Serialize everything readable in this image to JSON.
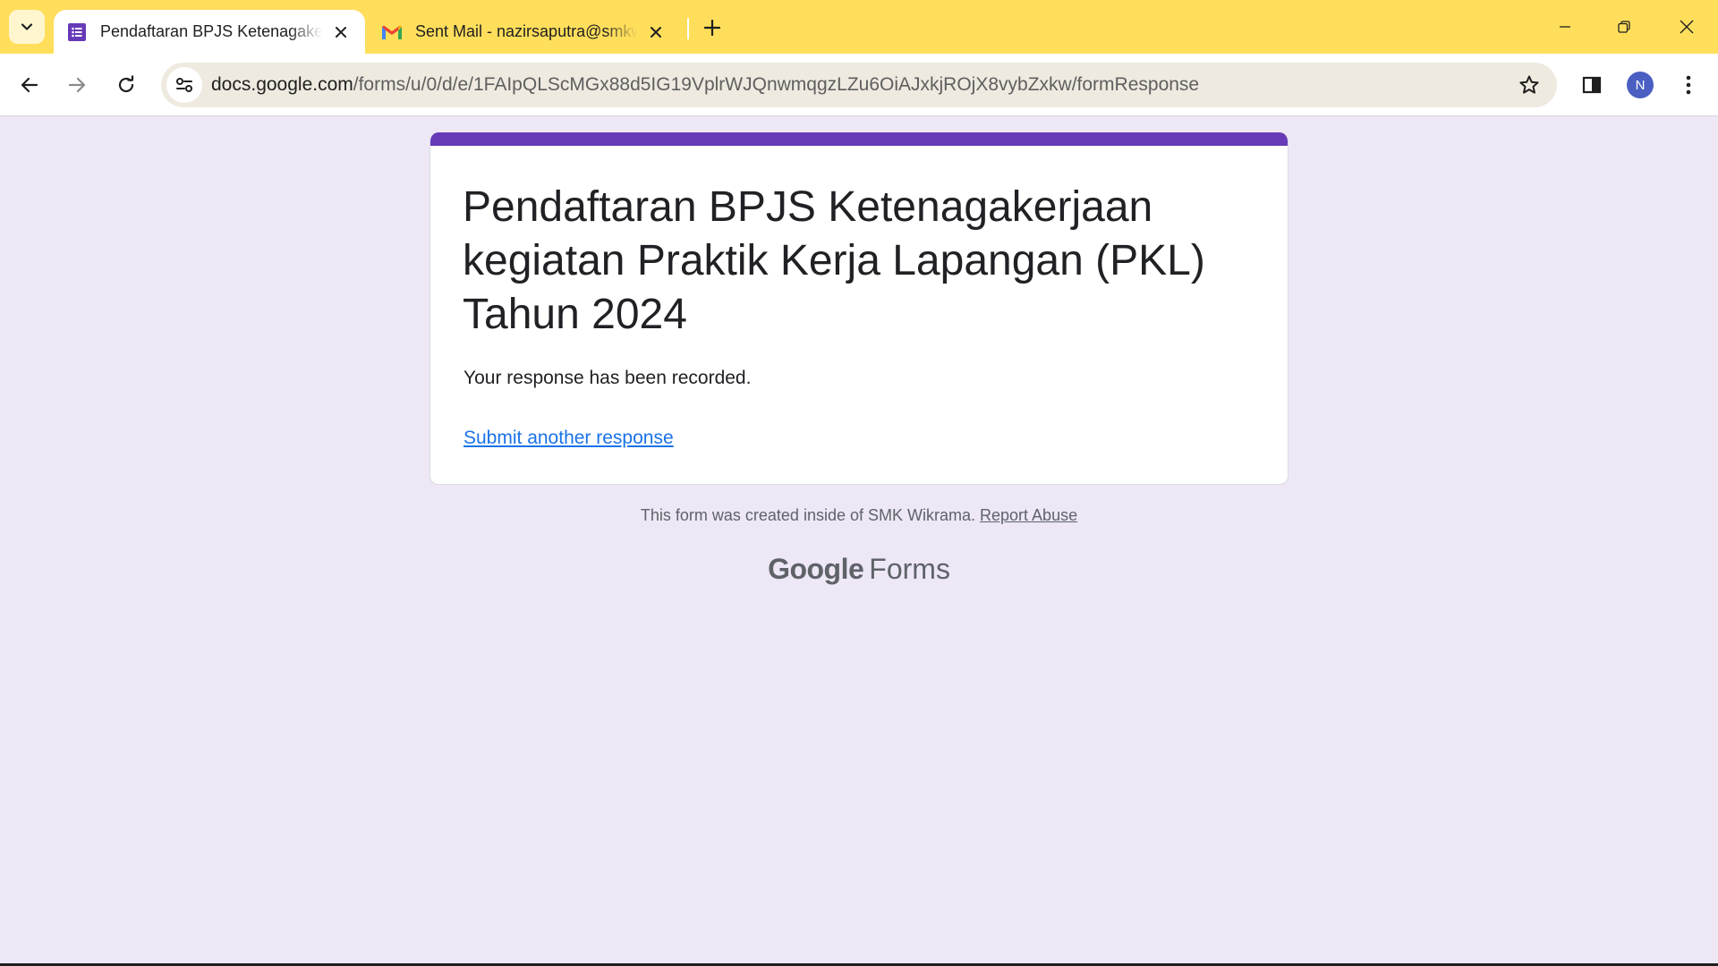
{
  "browser": {
    "tabs": [
      {
        "title": "Pendaftaran BPJS Ketenagakerjaan",
        "icon": "google-forms-icon",
        "active": true
      },
      {
        "title": "Sent Mail - nazirsaputra@smkwikrama.sch.id",
        "icon": "gmail-icon",
        "active": false
      }
    ],
    "url_host": "docs.google.com",
    "url_path": "/forms/u/0/d/e/1FAIpQLScMGx88d5IG19VplrWJQnwmqgzLZu6OiAJxkjROjX8vybZxkw/formResponse",
    "profile_initial": "N",
    "colors": {
      "tabstrip": "#ffde5c",
      "profile": "#4a5fc1"
    }
  },
  "form": {
    "title": "Pendaftaran BPJS Ketenagakerjaan kegiatan Praktik Kerja Lapangan (PKL) Tahun 2024",
    "confirmation": "Your response has been recorded.",
    "submit_another": "Submit another response",
    "accent_color": "#673ab7",
    "background_color": "#ede7f6"
  },
  "footer": {
    "created_text": "This form was created inside of SMK Wikrama.",
    "report_abuse": "Report Abuse",
    "brand_google": "Google",
    "brand_product": "Forms"
  }
}
